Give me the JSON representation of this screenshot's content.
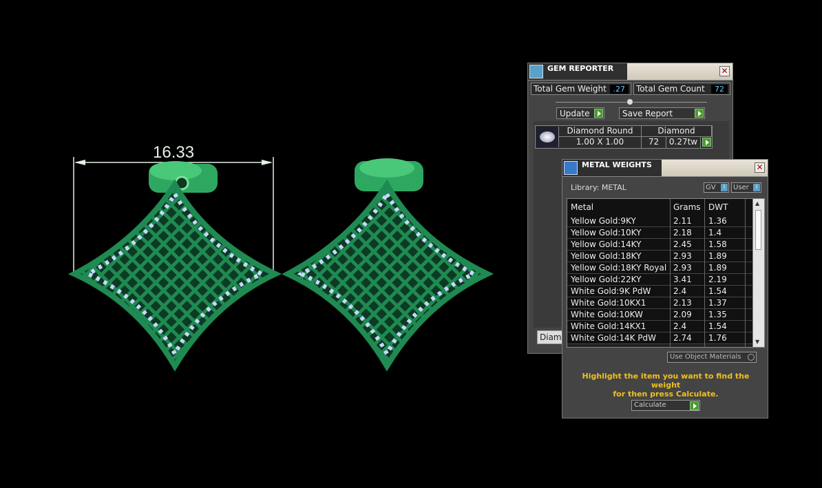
{
  "viewport": {
    "dimension_value": "16.33",
    "model_color": "#1f8a52",
    "stone_color": "#c8d8ff"
  },
  "gem_reporter": {
    "title": "GEM REPORTER",
    "total_gem_weight_label": "Total Gem Weight",
    "total_gem_weight_value": ".27",
    "total_gem_count_label": "Total Gem Count",
    "total_gem_count_value": "72",
    "update_label": "Update",
    "save_report_label": "Save Report",
    "gem_row": {
      "shape": "Diamond Round",
      "type": "Diamond",
      "size": "1.00 X 1.00",
      "count": "72",
      "weight": "0.27tw"
    },
    "bottom_button": "Diamond"
  },
  "metal_weights": {
    "title": "METAL WEIGHTS",
    "library_label": "Library: METAL",
    "gv_label": "GV",
    "user_label": "User",
    "columns": [
      "Metal",
      "Grams",
      "DWT"
    ],
    "rows": [
      [
        "Yellow Gold:9KY",
        "2.11",
        "1.36"
      ],
      [
        "Yellow Gold:10KY",
        "2.18",
        "1.4"
      ],
      [
        "Yellow Gold:14KY",
        "2.45",
        "1.58"
      ],
      [
        "Yellow Gold:18KY",
        "2.93",
        "1.89"
      ],
      [
        "Yellow Gold:18KY Royal",
        "2.93",
        "1.89"
      ],
      [
        "Yellow Gold:22KY",
        "3.41",
        "2.19"
      ],
      [
        "White Gold:9K PdW",
        "2.4",
        "1.54"
      ],
      [
        "White Gold:10KX1",
        "2.13",
        "1.37"
      ],
      [
        "White Gold:10KW",
        "2.09",
        "1.35"
      ],
      [
        "White Gold:14KX1",
        "2.4",
        "1.54"
      ],
      [
        "White Gold:14K PdW",
        "2.74",
        "1.76"
      ]
    ],
    "use_object_materials": "Use Object Materials",
    "hint_line1": "Highlight the item you want to find the weight",
    "hint_line2": "for then press Calculate.",
    "calculate_label": "Calculate"
  }
}
